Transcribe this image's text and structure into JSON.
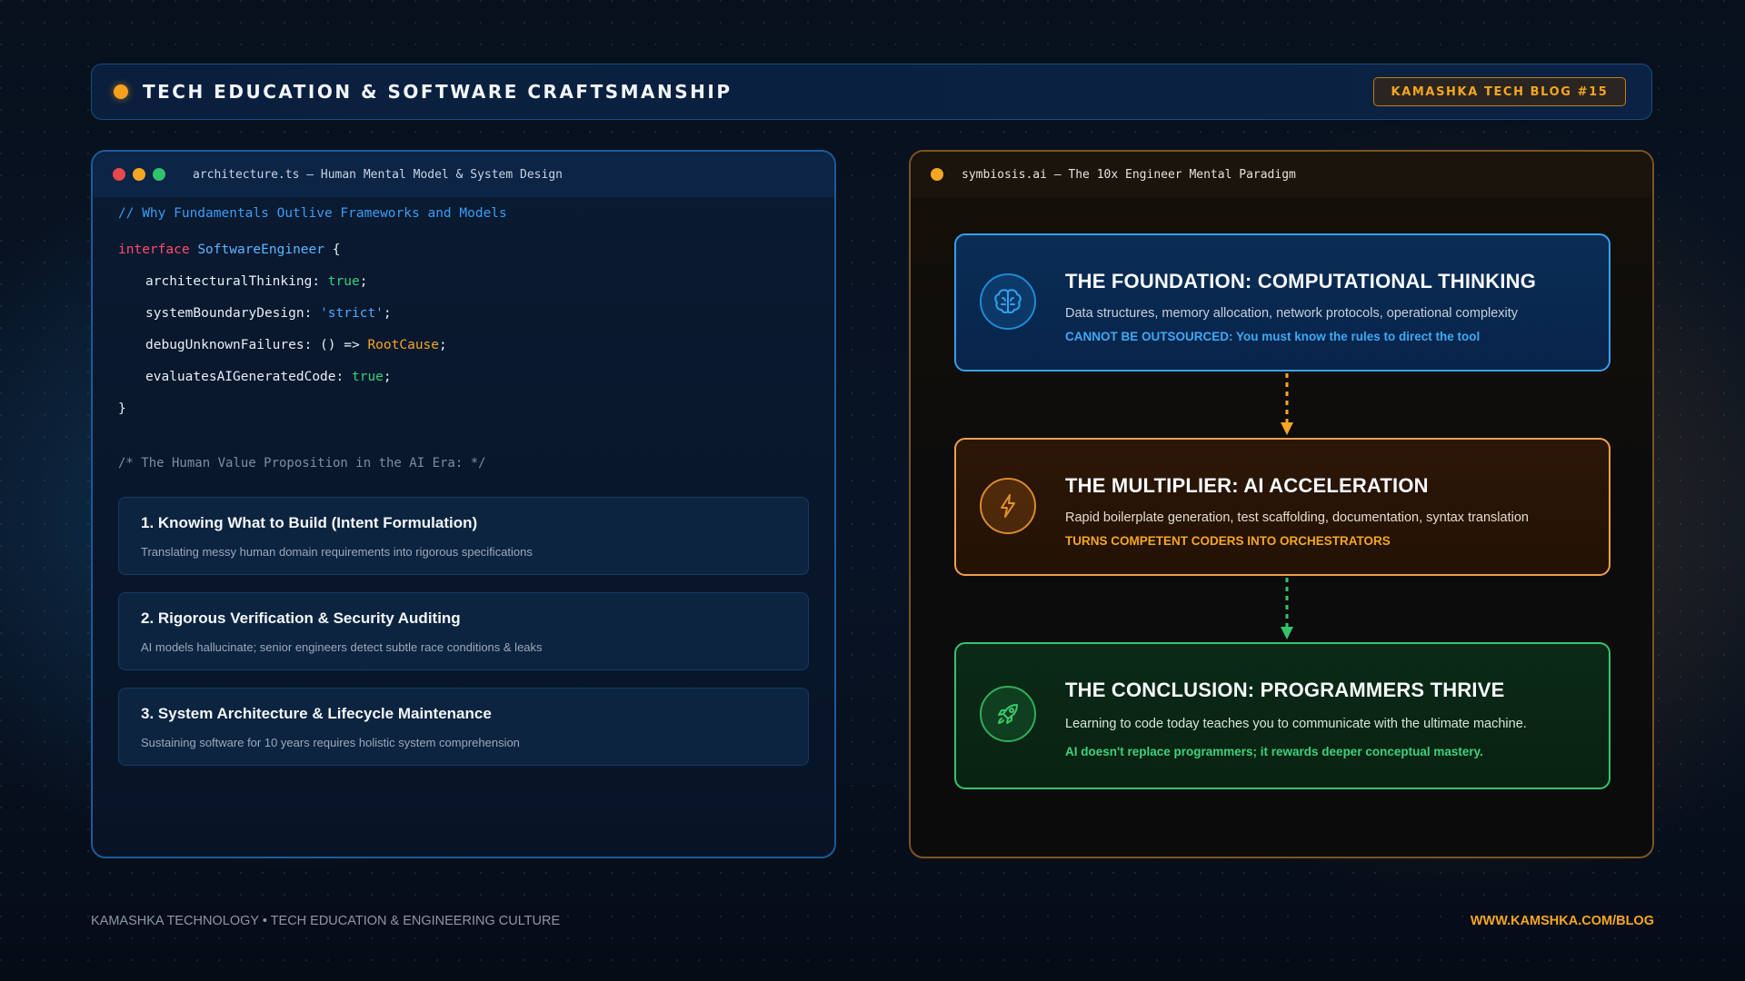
{
  "header": {
    "title": "TECH EDUCATION & SOFTWARE CRAFTSMANSHIP",
    "badge": "KAMASHKA TECH BLOG #15"
  },
  "left_panel": {
    "window_title": "architecture.ts — Human Mental Model & System Design",
    "code": {
      "comment": "// Why Fundamentals Outlive Frameworks and Models",
      "keyword": "interface",
      "type_name": "SoftwareEngineer",
      "open_brace": "{",
      "close_brace": "}",
      "lines": [
        {
          "key": "architecturalThinking: ",
          "value": "true",
          "end": ";"
        },
        {
          "key": "systemBoundaryDesign: ",
          "value": "'strict'",
          "end": ";"
        },
        {
          "key": "debugUnknownFailures: () => ",
          "value": "RootCause",
          "end": ";"
        },
        {
          "key": "evaluatesAIGeneratedCode: ",
          "value": "true",
          "end": ";"
        }
      ],
      "block_comment": "/* The Human Value Proposition in the AI Era: */"
    },
    "cards": [
      {
        "title": "1. Knowing What to Build (Intent Formulation)",
        "subtitle": "Translating messy human domain requirements into rigorous specifications"
      },
      {
        "title": "2. Rigorous Verification & Security Auditing",
        "subtitle": "AI models hallucinate; senior engineers detect subtle race conditions & leaks"
      },
      {
        "title": "3. System Architecture & Lifecycle Maintenance",
        "subtitle": "Sustaining software for 10 years requires holistic system comprehension"
      }
    ]
  },
  "right_panel": {
    "window_title": "symbiosis.ai — The 10x Engineer Mental Paradigm",
    "cards": [
      {
        "icon": "brain-icon",
        "title": "THE FOUNDATION: COMPUTATIONAL THINKING",
        "description": "Data structures, memory allocation, network protocols, operational complexity",
        "note": "CANNOT BE OUTSOURCED: You must know the rules to direct the tool"
      },
      {
        "icon": "lightning-icon",
        "title": "THE MULTIPLIER: AI ACCELERATION",
        "description": "Rapid boilerplate generation, test scaffolding, documentation, syntax translation",
        "note": "TURNS COMPETENT CODERS INTO ORCHESTRATORS"
      },
      {
        "icon": "rocket-icon",
        "title": "THE CONCLUSION: PROGRAMMERS THRIVE",
        "description": "Learning to code today teaches you to communicate with the ultimate machine.",
        "note": "AI doesn't replace programmers; it rewards deeper conceptual mastery."
      }
    ]
  },
  "footer": {
    "left": "KAMASHKA TECHNOLOGY • TECH EDUCATION & ENGINEERING CULTURE",
    "right": "WWW.KAMSHKA.COM/BLOG"
  },
  "colors": {
    "accent_orange": "#f5a623",
    "accent_blue": "#3a9fe8",
    "accent_green": "#35c46a",
    "keyword_red": "#ff4d6d"
  }
}
